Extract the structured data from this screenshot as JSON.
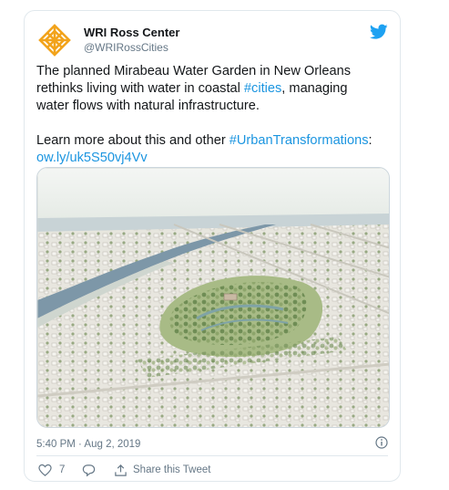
{
  "tweet": {
    "display_name": "WRI Ross Center",
    "handle": "@WRIRossCities",
    "text_line1_a": "The planned Mirabeau Water Garden in New Orleans",
    "text_line2_a": "rethinks living with water in coastal ",
    "text_hashtag1": "#cities",
    "text_line2_b": ", managing",
    "text_line3": "water flows with natural infrastructure.",
    "text_line4_a": "Learn more about this and other ",
    "text_hashtag2": "#UrbanTransformations",
    "text_line4_b": ":",
    "text_link": "ow.ly/uk5S50vj4Vv",
    "timestamp": "5:40 PM · Aug 2, 2019",
    "like_count": "7",
    "share_label": "Share this Tweet"
  },
  "icons": {
    "avatar": "wri-logo-icon",
    "platform": "twitter-bird-icon",
    "info": "info-icon",
    "like": "heart-icon",
    "reply": "reply-bubble-icon",
    "share": "share-upload-icon"
  },
  "colors": {
    "link": "#1b95e0",
    "brand_bird": "#1da1f2",
    "logo": "#f5a623",
    "muted": "#657786"
  }
}
